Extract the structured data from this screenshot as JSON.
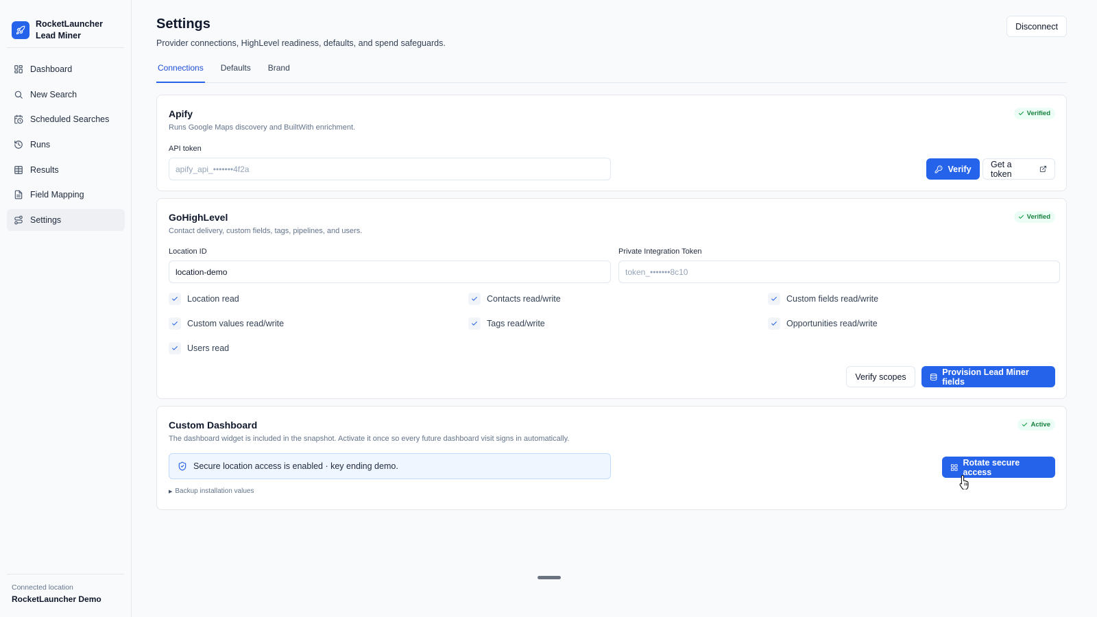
{
  "app": {
    "name_line1": "RocketLauncher",
    "name_line2": "Lead Miner",
    "logo_icon": "rocket-icon",
    "accent_color": "#2563eb"
  },
  "sidebar": {
    "items": [
      {
        "label": "Dashboard",
        "icon": "layout-grid-icon",
        "active": false
      },
      {
        "label": "New Search",
        "icon": "search-icon",
        "active": false
      },
      {
        "label": "Scheduled Searches",
        "icon": "calendar-clock-icon",
        "active": false
      },
      {
        "label": "Runs",
        "icon": "history-icon",
        "active": false
      },
      {
        "label": "Results",
        "icon": "table-icon",
        "active": false
      },
      {
        "label": "Field Mapping",
        "icon": "file-text-icon",
        "active": false
      },
      {
        "label": "Settings",
        "icon": "route-icon",
        "active": true
      }
    ],
    "footer": {
      "label": "Connected location",
      "value": "RocketLauncher Demo"
    }
  },
  "header": {
    "title": "Settings",
    "subtitle": "Provider connections, HighLevel readiness, defaults, and spend safeguards.",
    "disconnect_label": "Disconnect"
  },
  "tabs": [
    {
      "label": "Connections",
      "active": true
    },
    {
      "label": "Defaults",
      "active": false
    },
    {
      "label": "Brand",
      "active": false
    }
  ],
  "apify": {
    "title": "Apify",
    "description": "Runs Google Maps discovery and BuiltWith enrichment.",
    "badge": "Verified",
    "token_label": "API token",
    "token_placeholder": "apify_api_•••••••4f2a",
    "verify_label": "Verify",
    "get_token_label": "Get a token"
  },
  "gohighlevel": {
    "title": "GoHighLevel",
    "description": "Contact delivery, custom fields, tags, pipelines, and users.",
    "badge": "Verified",
    "location_label": "Location ID",
    "location_value": "location-demo",
    "token_label": "Private Integration Token",
    "token_placeholder": "token_•••••••8c10",
    "scopes": [
      "Location read",
      "Contacts read/write",
      "Custom fields read/write",
      "Custom values read/write",
      "Tags read/write",
      "Opportunities read/write",
      "Users read"
    ],
    "verify_scopes_label": "Verify scopes",
    "provision_label": "Provision Lead Miner fields"
  },
  "custom_dashboard": {
    "title": "Custom Dashboard",
    "description": "The dashboard widget is included in the snapshot. Activate it once so every future dashboard visit signs in automatically.",
    "badge": "Active",
    "info_text": "Secure location access is enabled · key ending demo.",
    "backup_label": "Backup installation values",
    "rotate_label": "Rotate secure access"
  }
}
